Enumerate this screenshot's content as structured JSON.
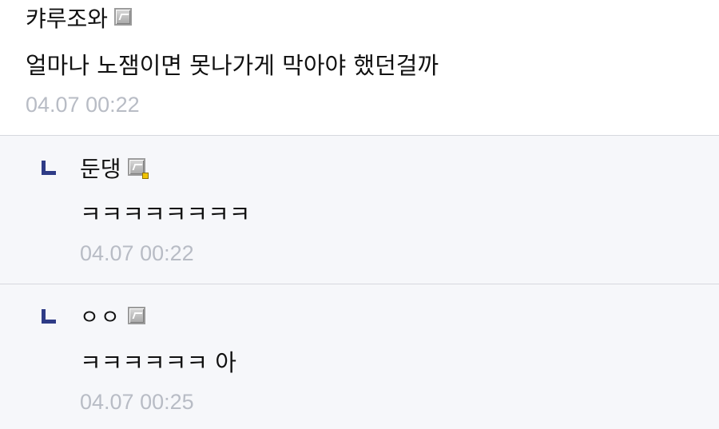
{
  "comments": [
    {
      "author": "캬루조와",
      "author_icon": "grade-icon",
      "text": "얼마나 노잼이면 못나가게 막아야 했던걸까",
      "timestamp": "04.07 00:22"
    }
  ],
  "replies": [
    {
      "marker": "reply-marker",
      "author": "둔댕",
      "author_icon": "grade-icon-with-badge",
      "text": "ㅋㅋㅋㅋㅋㅋㅋㅋ",
      "timestamp": "04.07 00:22"
    },
    {
      "marker": "reply-marker",
      "author": "ㅇㅇ",
      "author_icon": "grade-icon",
      "text": "ㅋㅋㅋㅋㅋㅋ 아",
      "timestamp": "04.07 00:25"
    }
  ],
  "colors": {
    "background": "#ffffff",
    "reply_background": "#f6f7fa",
    "divider": "#d6d8de",
    "reply_marker": "#2e3b86",
    "timestamp": "#b8bcc5",
    "badge_dot": "#f0c400"
  }
}
